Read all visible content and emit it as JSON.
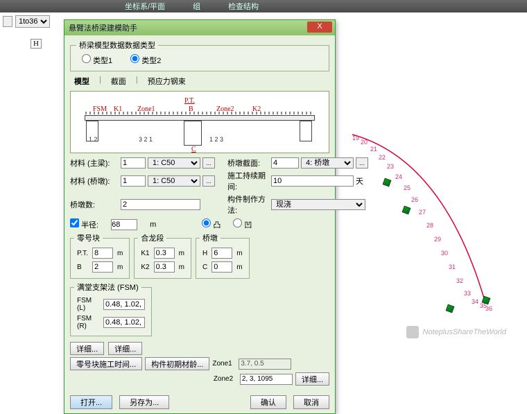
{
  "topbar": {
    "tab1": "坐标系/平面",
    "tab2": "组",
    "tab3": "检查结构"
  },
  "combo": {
    "sel": "1to36"
  },
  "dialog": {
    "title": "悬臂法桥梁建模助手",
    "close": "X",
    "data_type_legend": "桥梁模型数据数据类型",
    "radio1": "类型1",
    "radio2": "类型2",
    "tabs": {
      "a": "模型",
      "b": "截面",
      "c": "预应力钢束"
    },
    "diagram": {
      "fsm": "FSM",
      "k1": "K1",
      "zone1": "Zone1",
      "pt": "P.T.",
      "b": "B",
      "zone2": "Zone2",
      "k2": "K2",
      "h": "H",
      "c": "C"
    },
    "f": {
      "mat_main": "材料 (主梁):",
      "mat_main_n": "1",
      "mat_main_sel": "1: C50",
      "mat_pier": "材料 (桥墩):",
      "mat_pier_n": "1",
      "mat_pier_sel": "1: C50",
      "pier_sec": "桥墩截面:",
      "pier_sec_n": "4",
      "pier_sec_sel": "4: 桥墩",
      "dur": "施工持续期间:",
      "dur_v": "10",
      "dur_u": "天",
      "pier_count": "桥墩数:",
      "pier_count_v": "2",
      "method": "构件制作方法:",
      "method_v": "现浇",
      "radius": "半径:",
      "radius_v": "68",
      "radius_u": "m",
      "convex": "凸",
      "concave": "凹"
    },
    "g": {
      "zero": "零号块",
      "zero_pt": "P.T.",
      "zero_pt_v": "8",
      "zero_b": "B",
      "zero_b_v": "2",
      "close": "合龙段",
      "close_k1": "K1",
      "close_k1_v": "0.3",
      "close_k2": "K2",
      "close_k2_v": "0.3",
      "pier": "桥墩",
      "pier_h": "H",
      "pier_h_v": "6",
      "pier_c": "C",
      "pier_c_v": "0",
      "fsm": "满堂支架法 (FSM)",
      "fsm_l": "FSM (L)",
      "fsm_l_v": "0.48, 1.02,",
      "fsm_r": "FSM (R)",
      "fsm_r_v": "0.48, 1.02,",
      "u": "m",
      "detail": "详细..."
    },
    "z": {
      "zone1": "Zone1",
      "zone1_v": "3.7, 0.5",
      "zone2": "Zone2",
      "zone2_v": "2, 3, 1095",
      "detail": "详细..."
    },
    "btn": {
      "time": "零号块施工时间...",
      "init": "构件初期材龄..."
    },
    "foot": {
      "open": "打开...",
      "save": "另存为...",
      "ok": "确认",
      "cancel": "取消"
    }
  },
  "nodes": [
    "19",
    "20",
    "21",
    "22",
    "23",
    "24",
    "25",
    "26",
    "27",
    "28",
    "29",
    "30",
    "31",
    "32",
    "33",
    "34",
    "35",
    "36"
  ],
  "watermark": "NoteplusShareTheWorld"
}
